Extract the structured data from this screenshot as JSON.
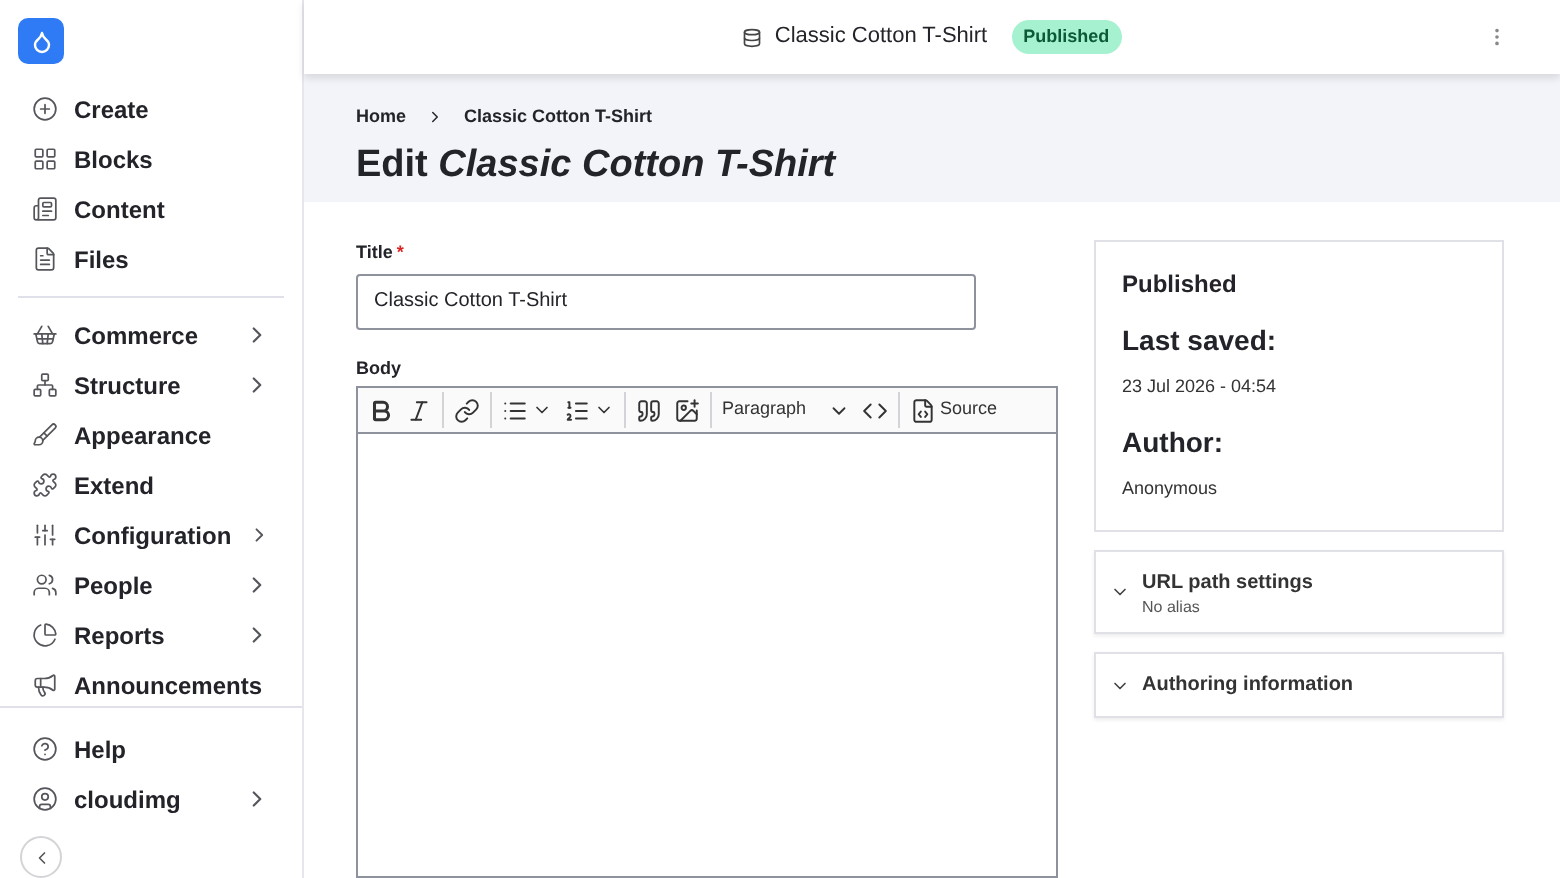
{
  "sidebar": {
    "primary": [
      {
        "kind": "create",
        "label": "Create",
        "has_children": false
      },
      {
        "kind": "blocks",
        "label": "Blocks",
        "has_children": false
      },
      {
        "kind": "content",
        "label": "Content",
        "has_children": false
      },
      {
        "kind": "files",
        "label": "Files",
        "has_children": false
      }
    ],
    "secondary": [
      {
        "kind": "commerce",
        "label": "Commerce",
        "has_children": true
      },
      {
        "kind": "structure",
        "label": "Structure",
        "has_children": true
      },
      {
        "kind": "appearance",
        "label": "Appearance",
        "has_children": false
      },
      {
        "kind": "extend",
        "label": "Extend",
        "has_children": false
      },
      {
        "kind": "configuration",
        "label": "Configuration",
        "has_children": true
      },
      {
        "kind": "people",
        "label": "People",
        "has_children": true
      },
      {
        "kind": "reports",
        "label": "Reports",
        "has_children": true
      },
      {
        "kind": "announcements",
        "label": "Announcements",
        "has_children": false
      }
    ],
    "footer": [
      {
        "kind": "help",
        "label": "Help",
        "has_children": false
      },
      {
        "kind": "user",
        "label": "cloudimg",
        "has_children": true
      }
    ]
  },
  "header": {
    "title": "Classic Cotton T-Shirt",
    "status": "Published"
  },
  "breadcrumb": [
    "Home",
    "Classic Cotton T-Shirt"
  ],
  "page_title": {
    "prefix": "Edit",
    "entity": "Classic Cotton T-Shirt"
  },
  "form": {
    "title_field": {
      "label": "Title",
      "required_mark": "*",
      "value": "Classic Cotton T-Shirt"
    },
    "body": {
      "label": "Body",
      "toolbar": [
        {
          "kind": "bold"
        },
        {
          "kind": "italic"
        },
        {
          "kind": "sep"
        },
        {
          "kind": "link"
        },
        {
          "kind": "sep"
        },
        {
          "kind": "bullets"
        },
        {
          "kind": "numbers"
        },
        {
          "kind": "sep"
        },
        {
          "kind": "quote"
        },
        {
          "kind": "image"
        },
        {
          "kind": "sep"
        },
        {
          "kind": "format",
          "label": "Paragraph"
        },
        {
          "kind": "code"
        },
        {
          "kind": "sep"
        },
        {
          "kind": "source",
          "label": "Source"
        }
      ]
    }
  },
  "meta": {
    "status": "Published",
    "last_saved_label": "Last saved:",
    "last_saved": "23 Jul 2026 - 04:54",
    "author_label": "Author:",
    "author": "Anonymous"
  },
  "panels": [
    {
      "title": "URL path settings",
      "summary": "No alias",
      "expanded": false
    },
    {
      "title": "Authoring information",
      "expanded": false
    }
  ]
}
